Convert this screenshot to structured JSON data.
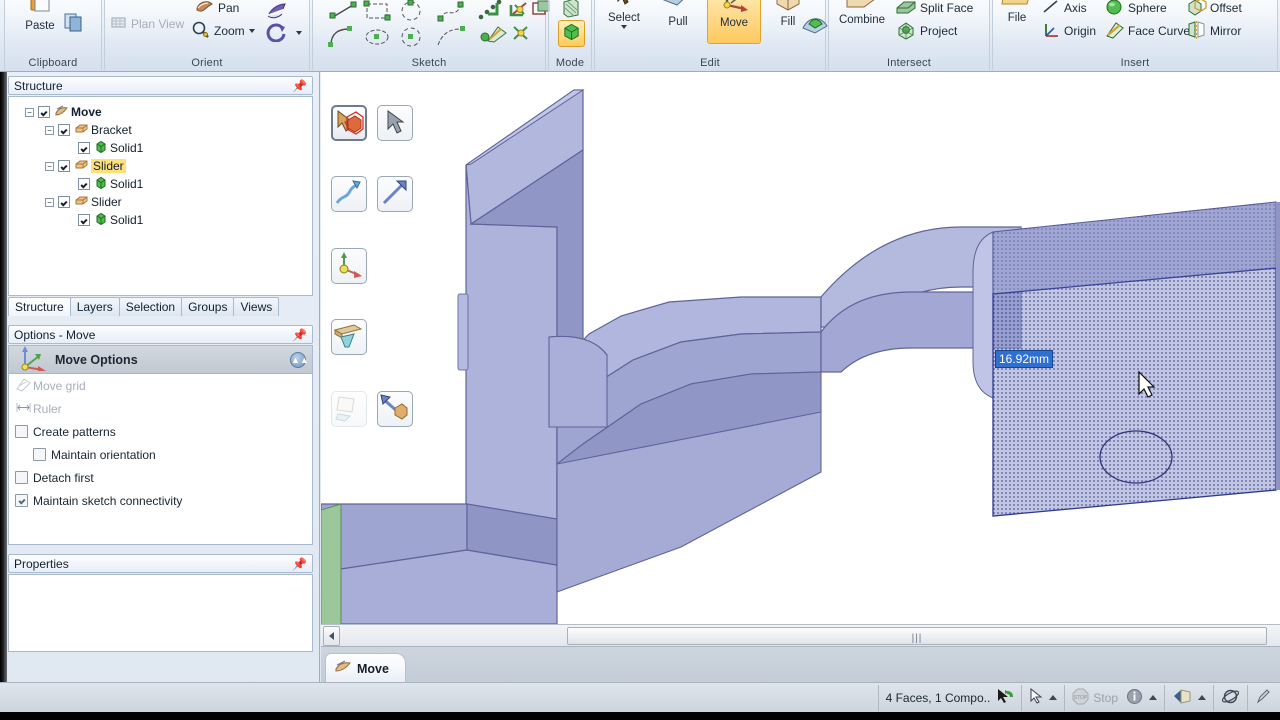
{
  "ribbon": {
    "groups": [
      {
        "title": "Clipboard",
        "items": [
          {
            "label": "Paste",
            "icon": "paste-icon"
          },
          {
            "label": "",
            "icon": "copy-icon"
          }
        ]
      },
      {
        "title": "Orient",
        "items": [
          {
            "label": "Plan View",
            "icon": "plan-view-icon",
            "disabled": true
          },
          {
            "label": "Pan",
            "icon": "pan-hand-icon"
          },
          {
            "label": "Zoom",
            "icon": "zoom-magnifier-icon",
            "dropdown": true
          },
          {
            "label": "",
            "icon": "spin-view-icon"
          },
          {
            "label": "",
            "icon": "rotate-view-icon",
            "dropdown": true
          }
        ]
      },
      {
        "title": "Sketch",
        "items": [
          {
            "label": "",
            "icon": "line-icon"
          },
          {
            "label": "",
            "icon": "rectangle-icon"
          },
          {
            "label": "",
            "icon": "circle-icon"
          },
          {
            "label": "",
            "icon": "spline-icon"
          },
          {
            "label": "",
            "icon": "point-dots-icon"
          },
          {
            "label": "",
            "icon": "corner-trim-icon"
          },
          {
            "label": "",
            "icon": "create-rounded-icon"
          },
          {
            "label": "",
            "icon": "offset-curve-icon"
          },
          {
            "label": "",
            "icon": "tangent-arc-icon"
          },
          {
            "label": "",
            "icon": "ellipse-icon"
          },
          {
            "label": "",
            "icon": "arc-3point-icon"
          },
          {
            "label": "",
            "icon": "curve-segment-icon"
          },
          {
            "label": "",
            "icon": "sketch-point-icon"
          },
          {
            "label": "",
            "icon": "project-to-sketch-icon"
          },
          {
            "label": "",
            "icon": "split-curve-icon"
          }
        ]
      },
      {
        "title": "Mode",
        "items": [
          {
            "label": "",
            "icon": "sketch-mode-icon"
          },
          {
            "label": "",
            "icon": "3d-mode-icon",
            "selected": true
          }
        ]
      },
      {
        "title": "Edit",
        "items": [
          {
            "label": "Select",
            "icon": "select-arrow-icon",
            "dropdown": true
          },
          {
            "label": "Pull",
            "icon": "pull-icon"
          },
          {
            "label": "Move",
            "icon": "move-icon",
            "selected": true
          },
          {
            "label": "Fill",
            "icon": "fill-icon"
          },
          {
            "label": "",
            "icon": "blend-icon"
          }
        ]
      },
      {
        "title": "Intersect",
        "items": [
          {
            "label": "Combine",
            "icon": "combine-icon"
          },
          {
            "label": "Split Face",
            "icon": "split-face-icon"
          },
          {
            "label": "Project",
            "icon": "project-icon"
          }
        ]
      },
      {
        "title": "Insert",
        "items": [
          {
            "label": "File",
            "icon": "insert-file-icon"
          },
          {
            "label": "Axis",
            "icon": "axis-icon"
          },
          {
            "label": "Origin",
            "icon": "origin-icon"
          },
          {
            "label": "Sphere",
            "icon": "sphere-icon"
          },
          {
            "label": "Face Curve",
            "icon": "face-curve-icon"
          },
          {
            "label": "Offset",
            "icon": "offset-icon"
          },
          {
            "label": "Mirror",
            "icon": "mirror-icon"
          }
        ]
      }
    ]
  },
  "structure": {
    "title": "Structure",
    "pin_icon": "pin-icon",
    "nodes": [
      {
        "label": "Move",
        "indent": 0,
        "bold": true,
        "highlight": false,
        "expander": "-",
        "icon": "document-move-icon"
      },
      {
        "label": "Bracket",
        "indent": 1,
        "bold": false,
        "highlight": false,
        "expander": "-",
        "icon": "component-icon"
      },
      {
        "label": "Solid1",
        "indent": 2,
        "bold": false,
        "highlight": false,
        "expander": "",
        "icon": "solid-icon"
      },
      {
        "label": "Slider",
        "indent": 1,
        "bold": false,
        "highlight": true,
        "expander": "-",
        "icon": "component-icon"
      },
      {
        "label": "Solid1",
        "indent": 2,
        "bold": false,
        "highlight": false,
        "expander": "",
        "icon": "solid-icon"
      },
      {
        "label": "Slider",
        "indent": 1,
        "bold": false,
        "highlight": false,
        "expander": "-",
        "icon": "component-icon"
      },
      {
        "label": "Solid1",
        "indent": 2,
        "bold": false,
        "highlight": false,
        "expander": "",
        "icon": "solid-icon"
      }
    ],
    "tabs": [
      {
        "label": "Structure",
        "active": true
      },
      {
        "label": "Layers",
        "active": false
      },
      {
        "label": "Selection",
        "active": false
      },
      {
        "label": "Groups",
        "active": false
      },
      {
        "label": "Views",
        "active": false
      }
    ]
  },
  "options": {
    "title": "Options - Move",
    "pin_icon": "pin-icon",
    "section_title": "Move Options",
    "section_icon": "move-axis-icon",
    "collapse_icon": "chevron-up-icon",
    "rows": [
      {
        "label": "Move grid",
        "type": "icon",
        "icon": "move-grid-icon",
        "disabled": true,
        "checked": false
      },
      {
        "label": "Ruler",
        "type": "icon",
        "icon": "ruler-icon",
        "disabled": true,
        "checked": false
      },
      {
        "label": "Create patterns",
        "type": "checkbox",
        "icon": "",
        "disabled": false,
        "checked": false
      },
      {
        "label": "Maintain orientation",
        "type": "checkbox",
        "icon": "",
        "indent": true,
        "disabled": false,
        "checked": false
      },
      {
        "label": "Detach first",
        "type": "checkbox",
        "icon": "",
        "disabled": false,
        "checked": false
      },
      {
        "label": "Maintain sketch connectivity",
        "type": "checkbox",
        "icon": "",
        "disabled": false,
        "checked": true
      }
    ]
  },
  "properties": {
    "title": "Properties",
    "pin_icon": "pin-icon"
  },
  "viewport": {
    "dimension_value": "16.92mm",
    "mini_toolbar": [
      {
        "name": "select-object-button",
        "icon": "cursor-box-icon",
        "selected": true,
        "ghost": false,
        "row": 0,
        "col": 0
      },
      {
        "name": "select-cursor-button",
        "icon": "arrow-cursor-icon",
        "selected": false,
        "ghost": false,
        "row": 0,
        "col": 1
      },
      {
        "name": "move-direction-button",
        "icon": "curved-arrow-icon",
        "selected": false,
        "ghost": false,
        "row": 1,
        "col": 0
      },
      {
        "name": "move-straight-button",
        "icon": "straight-arrow-icon",
        "selected": false,
        "ghost": false,
        "row": 1,
        "col": 1
      },
      {
        "name": "anchor-axis-button",
        "icon": "move-axis-icon",
        "selected": false,
        "ghost": false,
        "row": 2,
        "col": 0
      },
      {
        "name": "orient-to-plane-button",
        "icon": "plane-orient-icon",
        "selected": false,
        "ghost": false,
        "row": 3,
        "col": 0
      },
      {
        "name": "sketch-copy-button",
        "icon": "paper-copy-icon",
        "selected": false,
        "ghost": true,
        "row": 4,
        "col": 0
      },
      {
        "name": "direction-to-body-button",
        "icon": "arrow-to-box-icon",
        "selected": false,
        "ghost": false,
        "row": 4,
        "col": 1
      }
    ]
  },
  "scrollbar": {
    "left_arrow_icon": "chevron-left-icon",
    "grip_icon": "grip-dots"
  },
  "tooltab": {
    "label": "Move",
    "icon": "move-tool-icon"
  },
  "statusbar": {
    "selection_text": "4 Faces, 1 Compo..",
    "selection_icon": "selection-arrow-icon",
    "cursor_icon": "arrow-cursor-icon",
    "stop_label": "Stop",
    "stop_icon": "stop-sign-icon",
    "info_icon": "info-circle-icon",
    "render_icon": "render-view-icon",
    "orbit_icon": "orbit-icon",
    "pen_icon": "pen-icon"
  },
  "colors": {
    "accent_orange": "#ffc45e",
    "selection_blue": "#2f6fd0",
    "model_purple": "#a3a8d6",
    "model_green": "#8fc08f",
    "highlight_yellow": "#ffe07a",
    "bbox_orange": "#f5a623",
    "axis_red": "#e02020",
    "axis_green": "#1db31d",
    "axis_blue": "#2020c0"
  }
}
